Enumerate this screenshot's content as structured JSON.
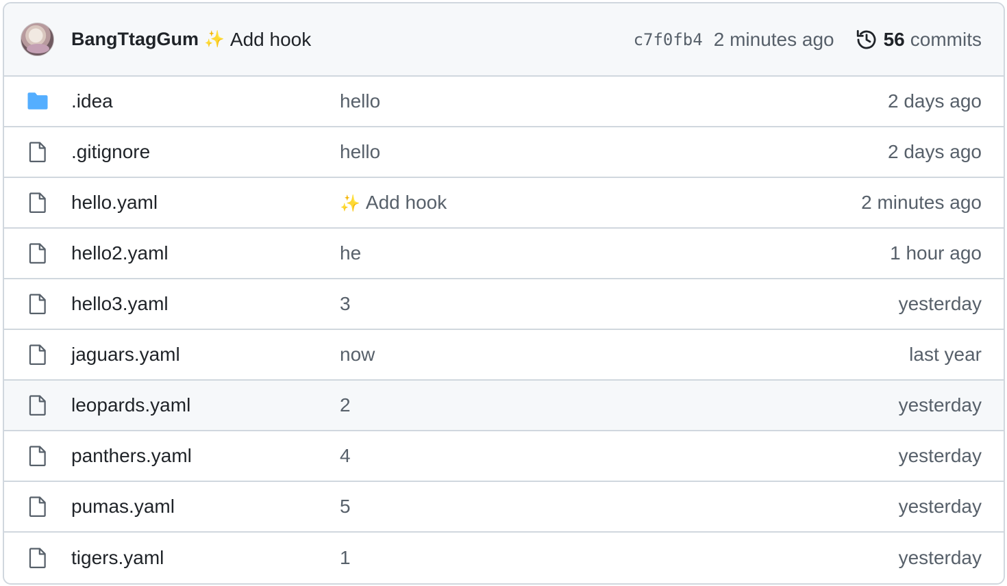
{
  "commit": {
    "author": "BangTtagGum",
    "emoji": "✨",
    "message": "Add hook",
    "sha": "c7f0fb4",
    "time": "2 minutes ago",
    "count": "56",
    "count_label": "commits"
  },
  "files": [
    {
      "name": ".idea",
      "type": "folder",
      "emoji": "",
      "message": "hello",
      "time": "2 days ago"
    },
    {
      "name": ".gitignore",
      "type": "file",
      "emoji": "",
      "message": "hello",
      "time": "2 days ago"
    },
    {
      "name": "hello.yaml",
      "type": "file",
      "emoji": "✨",
      "message": "Add hook",
      "time": "2 minutes ago"
    },
    {
      "name": "hello2.yaml",
      "type": "file",
      "emoji": "",
      "message": "he",
      "time": "1 hour ago"
    },
    {
      "name": "hello3.yaml",
      "type": "file",
      "emoji": "",
      "message": "3",
      "time": "yesterday"
    },
    {
      "name": "jaguars.yaml",
      "type": "file",
      "emoji": "",
      "message": "now",
      "time": "last year"
    },
    {
      "name": "leopards.yaml",
      "type": "file",
      "emoji": "",
      "message": "2",
      "time": "yesterday",
      "hovered": true
    },
    {
      "name": "panthers.yaml",
      "type": "file",
      "emoji": "",
      "message": "4",
      "time": "yesterday"
    },
    {
      "name": "pumas.yaml",
      "type": "file",
      "emoji": "",
      "message": "5",
      "time": "yesterday"
    },
    {
      "name": "tigers.yaml",
      "type": "file",
      "emoji": "",
      "message": "1",
      "time": "yesterday"
    }
  ],
  "colors": {
    "folder_icon": "#54aeff",
    "file_icon": "#57606a",
    "border": "#d0d7de",
    "header_bg": "#f6f8fa",
    "muted_text": "#57606a"
  },
  "icons": {
    "folder": "folder-icon",
    "file": "file-icon",
    "history": "history-icon",
    "avatar": "avatar"
  }
}
